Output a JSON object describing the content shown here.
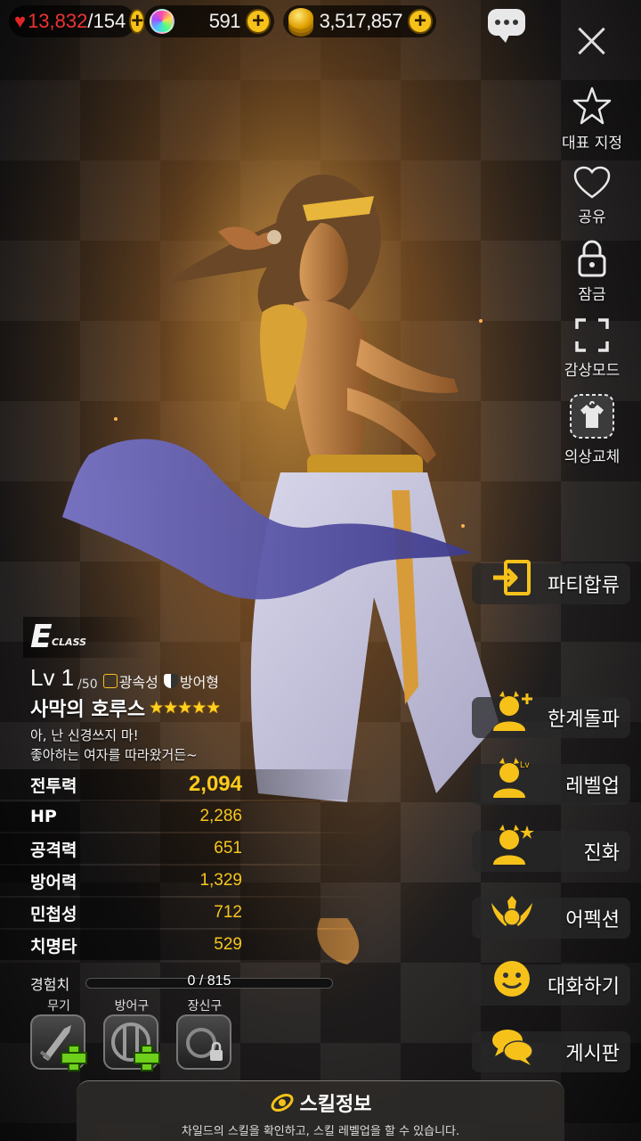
{
  "resources": {
    "stamina": {
      "current": "13,832",
      "max": "/154"
    },
    "gems": "591",
    "gold": "3,517,857"
  },
  "side_menu": [
    {
      "label": "대표 지정",
      "icon": "star-icon"
    },
    {
      "label": "공유",
      "icon": "heart-icon"
    },
    {
      "label": "잠금",
      "icon": "lock-icon"
    },
    {
      "label": "감상모드",
      "icon": "fullscreen-icon"
    },
    {
      "label": "의상교체",
      "icon": "costume-icon"
    }
  ],
  "actions": [
    {
      "label": "파티합류",
      "icon": "party-join-icon"
    },
    {
      "label": "한계돌파",
      "icon": "limit-break-icon"
    },
    {
      "label": "레벨업",
      "icon": "level-up-icon"
    },
    {
      "label": "진화",
      "icon": "evolve-icon"
    },
    {
      "label": "어펙션",
      "icon": "affection-icon"
    },
    {
      "label": "대화하기",
      "icon": "talk-icon"
    },
    {
      "label": "게시판",
      "icon": "board-icon"
    }
  ],
  "character": {
    "class_grade": "E",
    "class_word": "CLASS",
    "level": "Lv 1",
    "level_max": "/50",
    "element": "광속성",
    "role": "방어형",
    "name": "사막의 호루스",
    "stars": "★★★★★",
    "quote_line1": "아, 난 신경쓰지 마!",
    "quote_line2": "좋아하는 여자를 따라왔거든~"
  },
  "stats": [
    {
      "label": "전투력",
      "value": "2,094"
    },
    {
      "label": "HP",
      "value": "2,286"
    },
    {
      "label": "공격력",
      "value": "651"
    },
    {
      "label": "방어력",
      "value": "1,329"
    },
    {
      "label": "민첩성",
      "value": "712"
    },
    {
      "label": "치명타",
      "value": "529"
    }
  ],
  "experience": {
    "label": "경험치",
    "text": "0 / 815",
    "progress": 0
  },
  "equipment": [
    {
      "label": "무기",
      "state": "add"
    },
    {
      "label": "방어구",
      "state": "add"
    },
    {
      "label": "장신구",
      "state": "locked"
    }
  ],
  "skill_info": {
    "title": "스킬정보",
    "description": "차일드의 스킬을 확인하고, 스킬 레벨업을 할 수 있습니다."
  },
  "colors": {
    "accent": "#f6c21a",
    "stat_value": "#f7c61f",
    "plus_green": "#6fd01c"
  }
}
